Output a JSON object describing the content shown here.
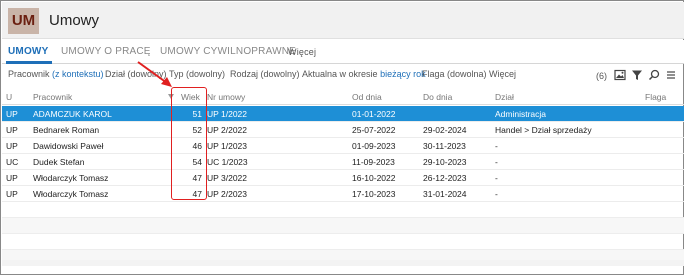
{
  "app": {
    "logo": "UM",
    "title": "Umowy"
  },
  "tabs": [
    {
      "label": "UMOWY",
      "active": true
    },
    {
      "label": "UMOWY O PRACĘ",
      "active": false
    },
    {
      "label": "UMOWY CYWILNOPRAWNE",
      "active": false
    },
    {
      "label": "Więcej",
      "active": false
    }
  ],
  "filters": {
    "pracownik_label": "Pracownik",
    "pracownik_value": "(z kontekstu)",
    "dzial": "Dział (dowolny)",
    "typ": "Typ (dowolny)",
    "rodzaj": "Rodzaj (dowolny)",
    "okres_label": "Aktualna w okresie",
    "okres_value": "bieżący rok",
    "flaga": "Flaga (dowolna)",
    "wiecej": "Więcej",
    "count": "(6)"
  },
  "table": {
    "columns": [
      "U",
      "Pracownik",
      "Wiek",
      "Nr umowy",
      "Od dnia",
      "Do dnia",
      "Dział",
      "Flaga"
    ],
    "rows": [
      {
        "u": "UP",
        "pracownik": "ADAMCZUK KAROL",
        "wiek": "51",
        "nr": "UP 1/2022",
        "od": "01-01-2022",
        "do": "",
        "dzial": "Administracja",
        "flaga": "",
        "selected": true
      },
      {
        "u": "UP",
        "pracownik": "Bednarek Roman",
        "wiek": "52",
        "nr": "UP 2/2022",
        "od": "25-07-2022",
        "do": "29-02-2024",
        "dzial": "Handel > Dział sprzedaży",
        "flaga": "",
        "selected": false
      },
      {
        "u": "UP",
        "pracownik": "Dawidowski Paweł",
        "wiek": "46",
        "nr": "UP 1/2023",
        "od": "01-09-2023",
        "do": "30-11-2023",
        "dzial": "-",
        "flaga": "",
        "selected": false
      },
      {
        "u": "UC",
        "pracownik": "Dudek Stefan",
        "wiek": "54",
        "nr": "UC 1/2023",
        "od": "11-09-2023",
        "do": "29-10-2023",
        "dzial": "-",
        "flaga": "",
        "selected": false
      },
      {
        "u": "UP",
        "pracownik": "Włodarczyk Tomasz",
        "wiek": "47",
        "nr": "UP 3/2022",
        "od": "16-10-2022",
        "do": "26-12-2023",
        "dzial": "-",
        "flaga": "",
        "selected": false
      },
      {
        "u": "UP",
        "pracownik": "Włodarczyk Tomasz",
        "wiek": "47",
        "nr": "UP 2/2023",
        "od": "17-10-2023",
        "do": "31-01-2024",
        "dzial": "-",
        "flaga": "",
        "selected": false
      }
    ]
  },
  "colors": {
    "accent": "#1e6fb8",
    "selection": "#1e8fd6",
    "annotation": "#e02020",
    "logo_bg": "#c9b4a8",
    "logo_fg": "#6b1f10"
  },
  "icons": [
    "image-icon",
    "filter-icon",
    "search-icon",
    "menu-icon",
    "sort-desc-icon"
  ]
}
